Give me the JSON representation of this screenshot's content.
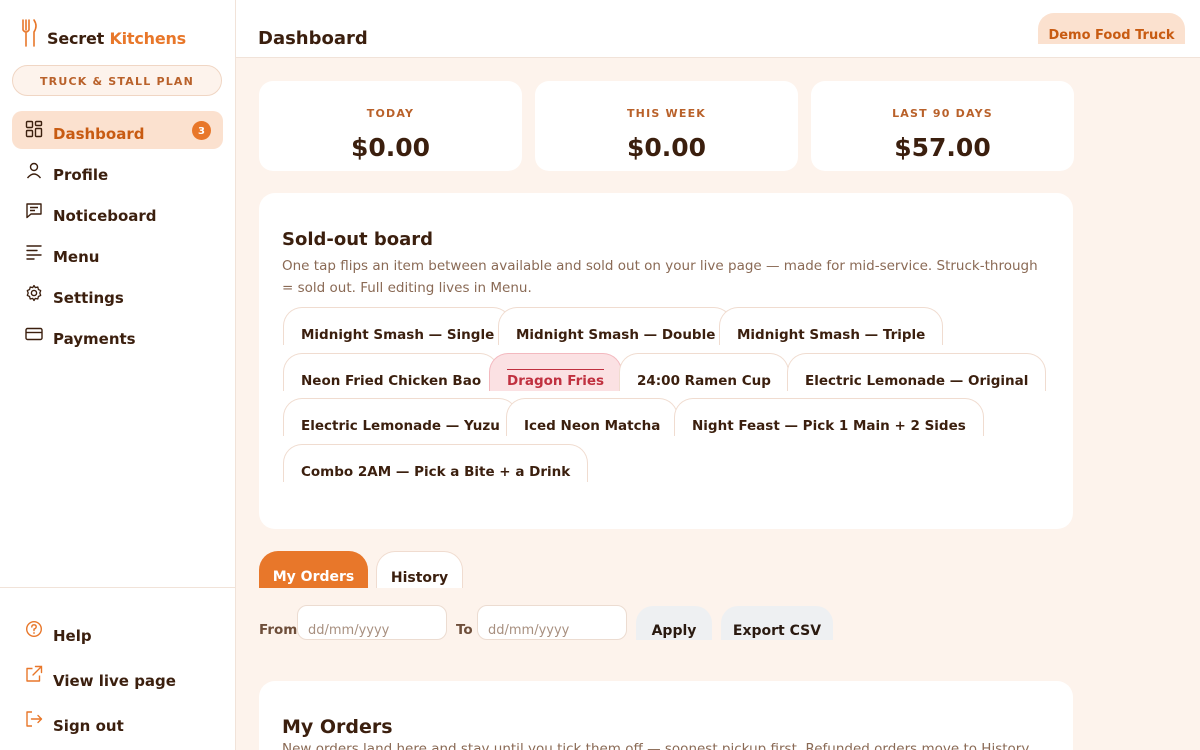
{
  "brand": {
    "name_part1": "Secret",
    "name_part2": "Kitchens",
    "logo_icon": "fork-knife-logo-icon"
  },
  "plan": {
    "label": "TRUCK & STALL PLAN"
  },
  "nav": {
    "items": [
      {
        "label": "Dashboard",
        "icon": "dashboard-grid-icon",
        "badge": "3"
      },
      {
        "label": "Profile",
        "icon": "user-icon"
      },
      {
        "label": "Noticeboard",
        "icon": "message-icon"
      },
      {
        "label": "Menu",
        "icon": "menu-lines-icon"
      },
      {
        "label": "Settings",
        "icon": "gear-icon"
      },
      {
        "label": "Payments",
        "icon": "credit-card-icon"
      }
    ],
    "bottom": [
      {
        "label": "Help",
        "icon": "help-icon"
      },
      {
        "label": "View live page",
        "icon": "external-link-icon"
      },
      {
        "label": "Sign out",
        "icon": "sign-out-icon"
      }
    ]
  },
  "header": {
    "title": "Dashboard",
    "truck_name": "Demo Food Truck"
  },
  "stats": [
    {
      "label": "TODAY",
      "value": "$0.00"
    },
    {
      "label": "THIS WEEK",
      "value": "$0.00"
    },
    {
      "label": "LAST 90 DAYS",
      "value": "$57.00"
    }
  ],
  "soldout": {
    "title": "Sold-out board",
    "description": "One tap flips an item between available and sold out on your live page — made for mid-service. Struck-through = sold out. Full editing lives in Menu.",
    "items": [
      {
        "label": "Midnight Smash — Single",
        "sold_out": false
      },
      {
        "label": "Midnight Smash — Double",
        "sold_out": false
      },
      {
        "label": "Midnight Smash — Triple",
        "sold_out": false
      },
      {
        "label": "Neon Fried Chicken Bao",
        "sold_out": false
      },
      {
        "label": "Dragon Fries",
        "sold_out": true
      },
      {
        "label": "24:00 Ramen Cup",
        "sold_out": false
      },
      {
        "label": "Electric Lemonade — Original",
        "sold_out": false
      },
      {
        "label": "Electric Lemonade — Yuzu",
        "sold_out": false
      },
      {
        "label": "Iced Neon Matcha",
        "sold_out": false
      },
      {
        "label": "Night Feast — Pick 1 Main + 2 Sides",
        "sold_out": false
      },
      {
        "label": "Combo 2AM — Pick a Bite + a Drink",
        "sold_out": false
      }
    ]
  },
  "tabs": [
    {
      "label": "My Orders",
      "active": true
    },
    {
      "label": "History",
      "active": false
    }
  ],
  "filter": {
    "from_label": "From",
    "to_label": "To",
    "from_placeholder": "dd/mm/yyyy",
    "to_placeholder": "dd/mm/yyyy",
    "apply_label": "Apply",
    "export_label": "Export CSV"
  },
  "orders": {
    "title": "My Orders",
    "description": "New orders land here and stay until you tick them off — soonest pickup first. Refunded orders move to History."
  },
  "colors": {
    "accent": "#e8772a",
    "background": "#fdf3ec",
    "text": "#3b1f0e",
    "sold_out": "#c0303f"
  }
}
